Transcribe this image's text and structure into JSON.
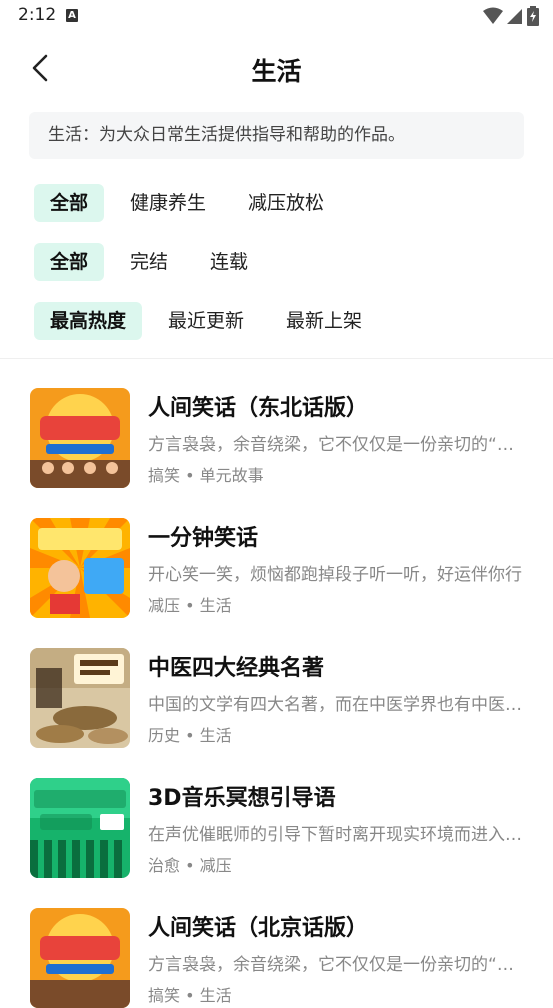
{
  "status_bar": {
    "time": "2:12",
    "notification_badge": "A"
  },
  "nav": {
    "title": "生活"
  },
  "description": "生活：为大众日常生活提供指导和帮助的作品。",
  "filters": {
    "category": [
      "全部",
      "健康养生",
      "减压放松"
    ],
    "status": [
      "全部",
      "完结",
      "连载"
    ],
    "sort": [
      "最高热度",
      "最近更新",
      "最新上架"
    ]
  },
  "items": [
    {
      "title": "人间笑话（东北话版）",
      "desc": "方言袅袅，余音绕梁，它不仅仅是一份亲切的“乡音”",
      "tags": "搞笑 • 单元故事",
      "cover_icon": "cartoon-comedy-cover"
    },
    {
      "title": "一分钟笑话",
      "desc": "开心笑一笑，烦恼都跑掉段子听一听，好运伴你行",
      "tags": "减压 • 生活",
      "cover_icon": "cartoon-boy-cover"
    },
    {
      "title": "中医四大经典名著",
      "desc": "中国的文学有四大名著，而在中医学界也有中医四大经典",
      "tags": "历史 • 生活",
      "cover_icon": "medicine-books-cover"
    },
    {
      "title": "3D音乐冥想引导语",
      "desc": "在声优催眠师的引导下暂时离开现实环境而进入冥想",
      "tags": "治愈 • 减压",
      "cover_icon": "green-field-cover"
    },
    {
      "title": "人间笑话（北京话版）",
      "desc": "方言袅袅，余音绕梁，它不仅仅是一份亲切的“乡音”",
      "tags": "搞笑 • 生活",
      "cover_icon": "cartoon-comedy-cover"
    }
  ],
  "colors": {
    "chip_active_bg": "#dcf7ee",
    "accent_text": "#111111",
    "muted_text": "#888888"
  }
}
